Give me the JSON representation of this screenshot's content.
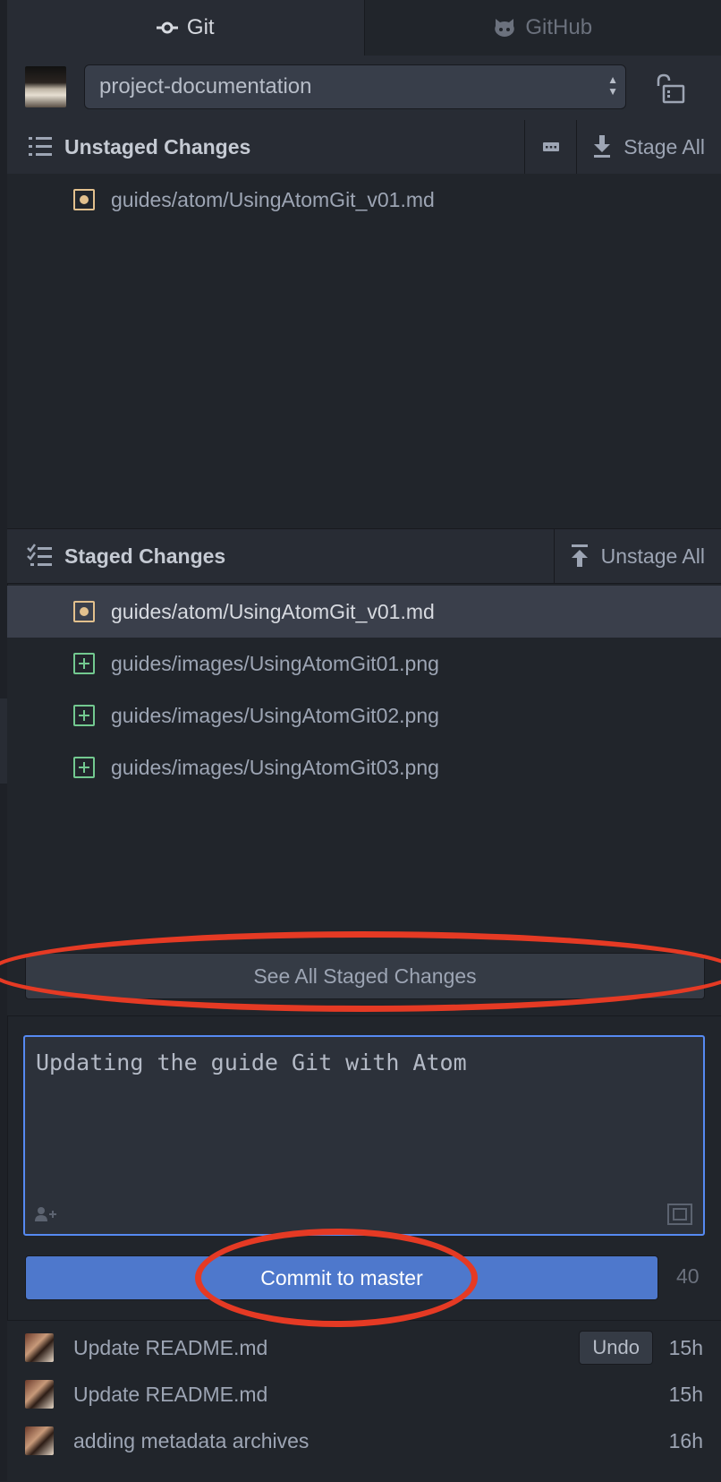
{
  "tabs": [
    {
      "label": "Git",
      "icon": "git-commit-icon",
      "active": true
    },
    {
      "label": "GitHub",
      "icon": "octocat-icon",
      "active": false
    }
  ],
  "repo": {
    "selected": "project-documentation"
  },
  "unstaged": {
    "title": "Unstaged Changes",
    "stage_all": "Stage All",
    "files": [
      {
        "path": "guides/atom/UsingAtomGit_v01.md",
        "status": "modified"
      }
    ]
  },
  "staged": {
    "title": "Staged Changes",
    "unstage_all": "Unstage All",
    "files": [
      {
        "path": "guides/atom/UsingAtomGit_v01.md",
        "status": "modified",
        "selected": true
      },
      {
        "path": "guides/images/UsingAtomGit01.png",
        "status": "added"
      },
      {
        "path": "guides/images/UsingAtomGit02.png",
        "status": "added"
      },
      {
        "path": "guides/images/UsingAtomGit03.png",
        "status": "added"
      }
    ],
    "see_all": "See All Staged Changes"
  },
  "commit": {
    "message": "Updating the guide Git with Atom",
    "button": "Commit to master",
    "remaining_chars": "40"
  },
  "recent_commits": [
    {
      "message": "Update README.md",
      "time": "15h",
      "undo": "Undo"
    },
    {
      "message": "Update README.md",
      "time": "15h"
    },
    {
      "message": "adding metadata archives",
      "time": "16h"
    }
  ],
  "colors": {
    "background": "#21252b",
    "accent": "#568af2",
    "commit_button": "#4e78cc",
    "modified": "#e2c08d",
    "added": "#73c990",
    "annotation": "#e53a24"
  }
}
